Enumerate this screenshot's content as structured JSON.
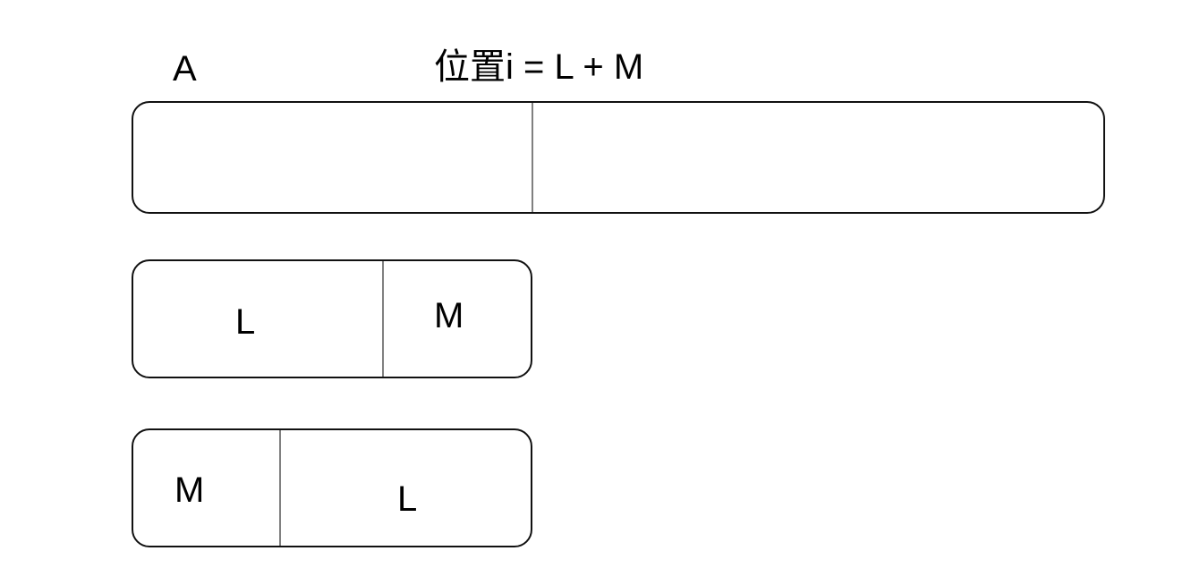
{
  "labels": {
    "array_name": "A",
    "position_formula": "位置i = L + M"
  },
  "arrays": [
    {
      "name": "full-array",
      "segments": []
    },
    {
      "name": "l-then-m",
      "segments": [
        "L",
        "M"
      ]
    },
    {
      "name": "m-then-l",
      "segments": [
        "M",
        "L"
      ]
    }
  ]
}
